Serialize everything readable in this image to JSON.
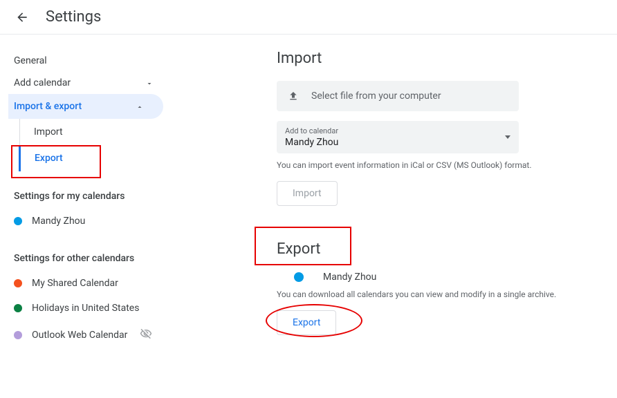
{
  "header": {
    "title": "Settings"
  },
  "sidebar": {
    "general": "General",
    "add_calendar": "Add calendar",
    "import_export": "Import & export",
    "sub": {
      "import": "Import",
      "export": "Export"
    },
    "my_heading": "Settings for my calendars",
    "my_calendars": [
      {
        "name": "Mandy Zhou",
        "color": "#039be5"
      }
    ],
    "other_heading": "Settings for other calendars",
    "other_calendars": [
      {
        "name": "My Shared Calendar",
        "color": "#f4511e",
        "hidden": false
      },
      {
        "name": "Holidays in United States",
        "color": "#0b8043",
        "hidden": false
      },
      {
        "name": "Outlook Web Calendar",
        "color": "#b39ddb",
        "hidden": true
      }
    ]
  },
  "main": {
    "import": {
      "title": "Import",
      "file_label": "Select file from your computer",
      "dropdown_label": "Add to calendar",
      "dropdown_value": "Mandy Zhou",
      "help": "You can import event information in iCal or CSV (MS Outlook) format.",
      "button": "Import"
    },
    "export": {
      "title": "Export",
      "calendar": {
        "name": "Mandy Zhou",
        "color": "#039be5"
      },
      "help": "You can download all calendars you can view and modify in a single archive.",
      "button": "Export"
    }
  }
}
